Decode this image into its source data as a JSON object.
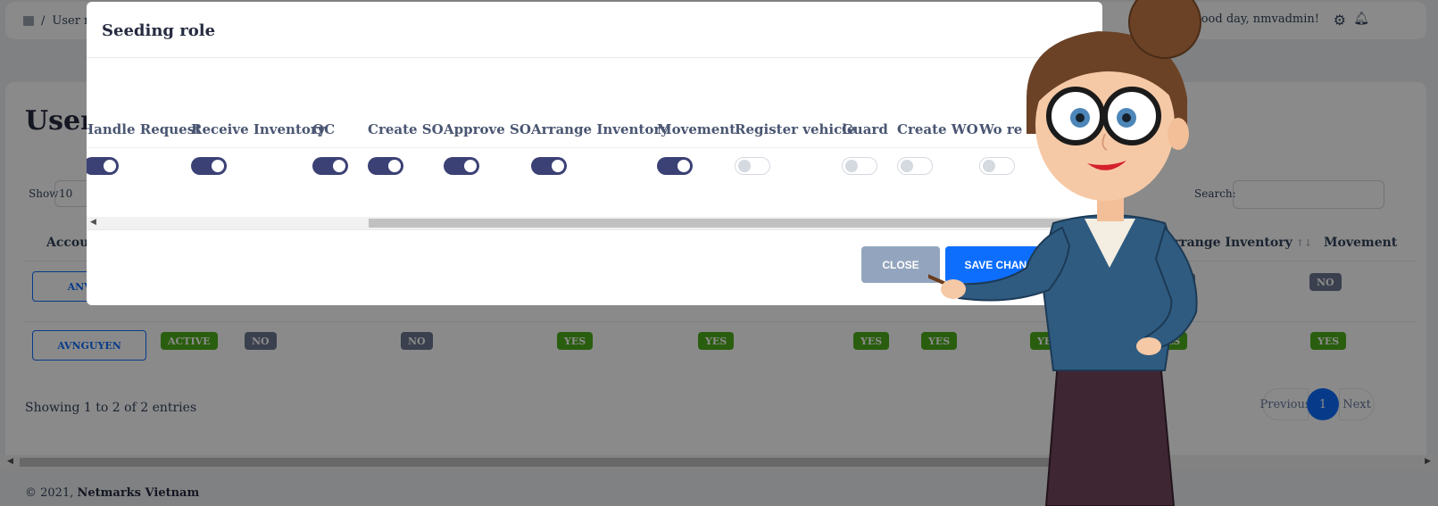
{
  "topbar": {
    "breadcrumb_sep": "/",
    "breadcrumb_current": "User rol",
    "greeting": "Good day, nmvadmin!"
  },
  "page": {
    "title": "User r",
    "show_label": "Show",
    "show_value": "10",
    "search_label": "Search:",
    "search_value": ""
  },
  "table": {
    "headers": {
      "account": "Accou",
      "arrange_inventory": "Arrange Inventory",
      "movement": "Movement"
    },
    "rows": [
      {
        "account": "ANVA",
        "badges": [
          "NO",
          "NO"
        ]
      },
      {
        "account": "AVNGUYEN",
        "status": "ACTIVE",
        "badges": [
          "NO",
          "NO",
          "YES",
          "YES",
          "YES",
          "YES",
          "YES",
          "YES",
          "YES"
        ]
      }
    ]
  },
  "pagination": {
    "info": "Showing 1 to 2 of 2 entries",
    "previous": "Previous",
    "current": "1",
    "next": "Next"
  },
  "footer": {
    "prefix": "© 2021, ",
    "company": "Netmarks Vietnam"
  },
  "modal": {
    "title": "Seeding role",
    "columns": [
      {
        "label": "Handle Request",
        "enabled": true
      },
      {
        "label": "Receive Inventory",
        "enabled": true
      },
      {
        "label": "QC",
        "enabled": true
      },
      {
        "label": "Create SO",
        "enabled": true
      },
      {
        "label": "Approve SO",
        "enabled": true
      },
      {
        "label": "Arrange Inventory",
        "enabled": true
      },
      {
        "label": "Movement",
        "enabled": true
      },
      {
        "label": "Register vehicle",
        "enabled": false
      },
      {
        "label": "Guard",
        "enabled": false
      },
      {
        "label": "Create WO",
        "enabled": false
      },
      {
        "label": "Wo re",
        "enabled": false
      }
    ],
    "close_label": "CLOSE",
    "save_label": "SAVE CHANGE"
  },
  "colors": {
    "primary": "#0d6efd",
    "toggle_on": "#3b4175",
    "badge_yes": "#4fae1c",
    "badge_no": "#6b7690"
  },
  "icons": [
    "home-icon",
    "user-icon",
    "gear-icon",
    "bell-icon"
  ]
}
